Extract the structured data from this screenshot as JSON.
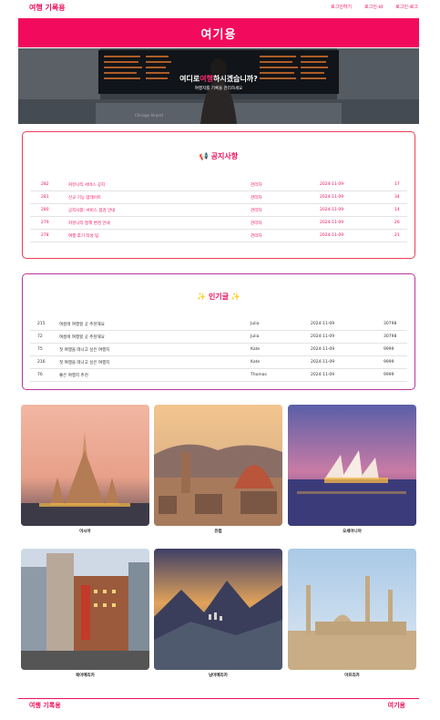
{
  "header": {
    "brand": "여행 기록용",
    "nav": [
      "로그인하기",
      "로그인-id",
      "로그인-로그"
    ]
  },
  "banner": {
    "title": "여기용"
  },
  "hero": {
    "title_before": "여디로",
    "title_highlight": "여행",
    "title_after": "하시겠습니까?",
    "subtitle": "여행지를 기록을 관리하세요",
    "stamp": "Chicago Airport"
  },
  "notice": {
    "title": "📢 공지사항",
    "rows": [
      {
        "id": "282",
        "title": "커뮤니티 서비스 공지",
        "author": "관리자",
        "date": "2024-11-09",
        "views": "17"
      },
      {
        "id": "281",
        "title": "신규 기능 업데이트",
        "author": "관리자",
        "date": "2024-11-09",
        "views": "34"
      },
      {
        "id": "280",
        "title": "공지사항: 서비스 점검 안내",
        "author": "관리자",
        "date": "2024-11-09",
        "views": "14"
      },
      {
        "id": "279",
        "title": "커뮤니티 정책 변경 안내",
        "author": "관리자",
        "date": "2024-11-09",
        "views": "26"
      },
      {
        "id": "278",
        "title": "여행 후기 작성 팁",
        "author": "관리자",
        "date": "2024-11-09",
        "views": "21"
      }
    ]
  },
  "popular": {
    "title": "✨ 인기글 ✨",
    "rows": [
      {
        "id": "215",
        "title": "여름에 여행할 곳 추천해요",
        "author": "Julia",
        "date": "2024-11-09",
        "views": "30798"
      },
      {
        "id": "72",
        "title": "여름에 여행할 곳 추천해요",
        "author": "Julia",
        "date": "2024-11-09",
        "views": "30798"
      },
      {
        "id": "75",
        "title": "첫 여행을 떠나고 싶은 여행지",
        "author": "Kate",
        "date": "2024-11-09",
        "views": "9999"
      },
      {
        "id": "216",
        "title": "첫 여행을 떠나고 싶은 여행지",
        "author": "Kate",
        "date": "2024-11-09",
        "views": "9999"
      },
      {
        "id": "76",
        "title": "좋은 여행지 추천",
        "author": "Thomas",
        "date": "2024-11-09",
        "views": "9999"
      }
    ]
  },
  "destinations": [
    {
      "label": "아시아"
    },
    {
      "label": "유럽"
    },
    {
      "label": "오세아니아"
    },
    {
      "label": "북아메리카"
    },
    {
      "label": "남아메리카"
    },
    {
      "label": "아프리카"
    }
  ],
  "footer": {
    "brand": "여행 기록용",
    "right": "여기용"
  },
  "colors": {
    "accent": "#ee0f5c",
    "notice_border": "#ea3f57",
    "popular_border": "#b9369a"
  }
}
